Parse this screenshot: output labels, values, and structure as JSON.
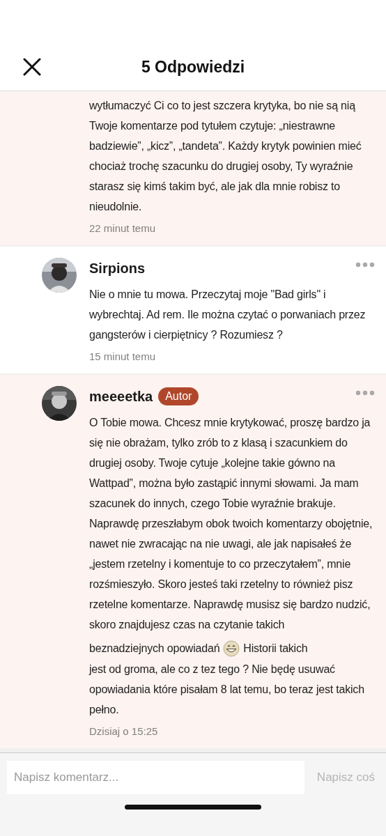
{
  "header": {
    "title": "5 Odpowiedzi"
  },
  "comments": [
    {
      "highlighted": true,
      "body": [
        [
          {
            "kind": "text",
            "text": "wytłumaczyć Ci co to jest szczera krytyka, bo nie są nią Twoje komentarze pod tytułem czytuje: „niestrawne badziewie”, „kicz”, „tandeta”. Każdy krytyk powinien mieć chociaż trochę szacunku do drugiej osoby, Ty wyraźnie starasz się kimś takim być, ale jak dla mnie robisz to nieudolnie."
          }
        ]
      ],
      "time": "22 minut temu"
    },
    {
      "author": "Sirpions",
      "highlighted": false,
      "body": [
        [
          {
            "kind": "text",
            "text": "Nie o mnie tu mowa. Przeczytaj moje \"Bad girls\" i wybrechtaj. Ad rem. Ile można czytać o porwaniach przez gangsterów i cierpiętnicy ? Rozumiesz ?"
          }
        ]
      ],
      "time": "15 minut temu"
    },
    {
      "author": "meeeetka",
      "badge": "Autor",
      "highlighted": true,
      "body": [
        [
          {
            "kind": "text",
            "text": "O Tobie mowa. Chcesz mnie krytykować, proszę bardzo ja się nie obrażam, tylko zrób to z klasą i szacunkiem do drugiej osoby. Twoje cytuje „kolejne takie gówno na Wattpad”, można było zastąpić innymi słowami. Ja mam szacunek do innych, czego Tobie wyraźnie brakuje. Naprawdę przeszłabym obok twoich komentarzy obojętnie, nawet nie zwracając na nie uwagi, ale jak napisałeś że „jestem rzetelny i komentuje to co przeczytałem”, mnie rozśmieszyło. Skoro jesteś taki rzetelny to również pisz rzetelne komentarze. Naprawdę musisz się bardzo nudzić, skoro znajdujesz czas na czytanie takich"
          }
        ],
        [
          {
            "kind": "text",
            "text": "beznadziejnych opowiadań"
          },
          {
            "kind": "emoji"
          },
          {
            "kind": "text",
            "text": "Historii takich"
          }
        ],
        [
          {
            "kind": "text",
            "text": "jest od groma, ale co z tez tego ? Nie będę usuwać opowiadania które pisałam 8 lat temu, bo teraz jest takich pełno."
          }
        ]
      ],
      "time": "Dzisiaj o 15:25"
    }
  ],
  "composer": {
    "placeholder": "Napisz komentarz...",
    "send": {
      "label": "Napisz coś",
      "disabled": true
    }
  }
}
